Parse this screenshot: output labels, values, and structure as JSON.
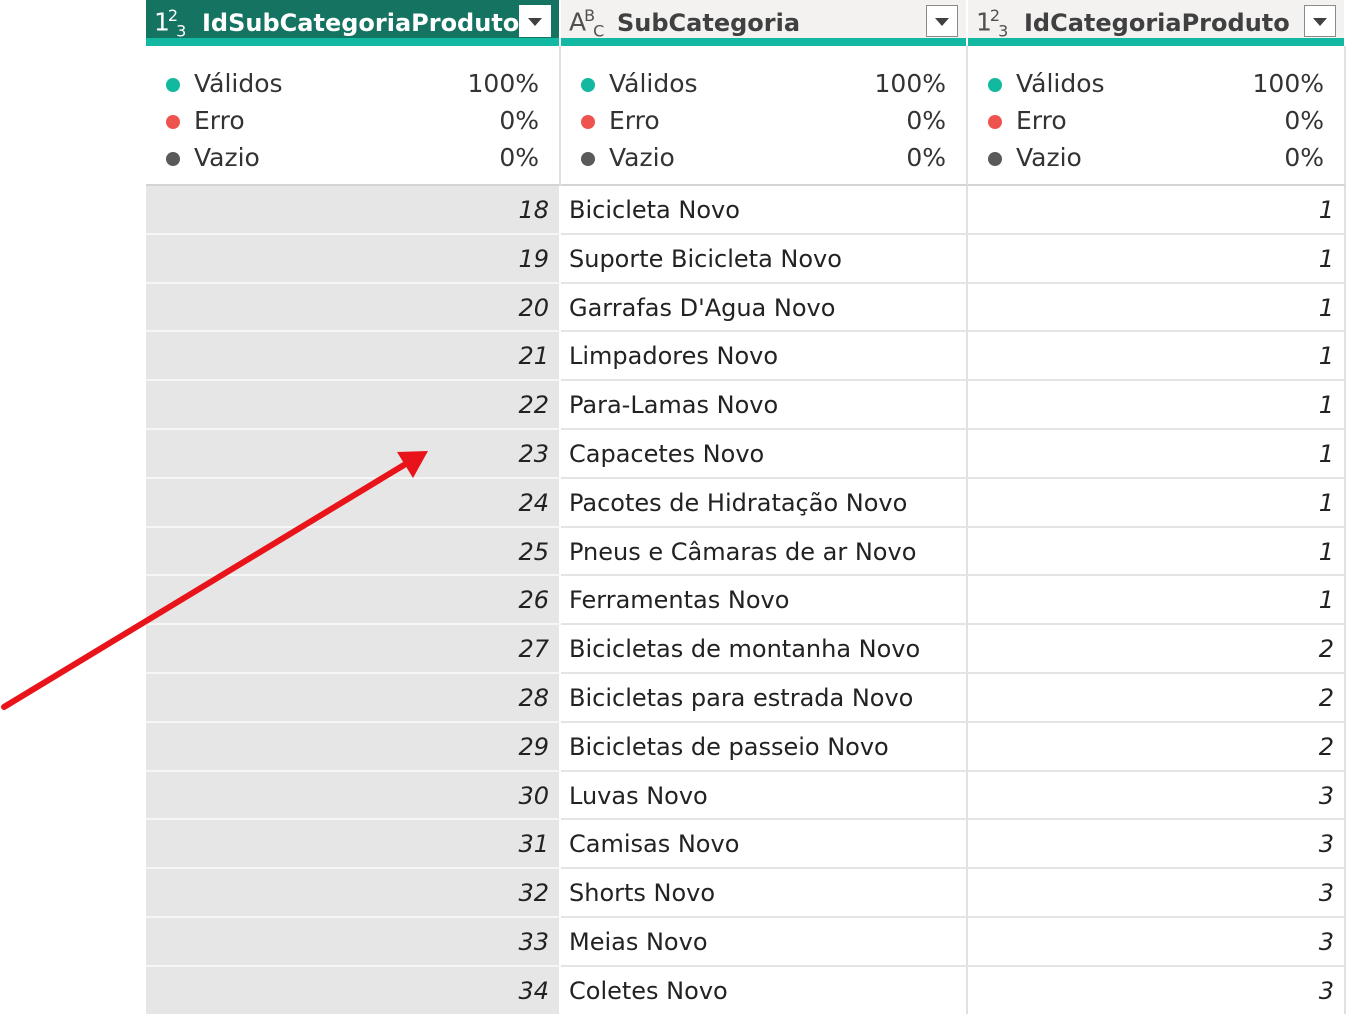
{
  "quality_labels": [
    "Válidos",
    "Erro",
    "Vazio"
  ],
  "quality_colors": {
    "valid": "#12b8a0",
    "error": "#ef5350",
    "empty": "#5a5a5a"
  },
  "columns": [
    {
      "name": "IdSubCategoriaProduto",
      "type_icon": "whole-number-type-icon",
      "selected": true,
      "quality": [
        "100%",
        "0%",
        "0%"
      ]
    },
    {
      "name": "SubCategoria",
      "type_icon": "text-type-icon",
      "selected": false,
      "quality": [
        "100%",
        "0%",
        "0%"
      ]
    },
    {
      "name": "IdCategoriaProduto",
      "type_icon": "whole-number-type-icon",
      "selected": false,
      "quality": [
        "100%",
        "0%",
        "0%"
      ]
    }
  ],
  "rows": [
    [
      "18",
      "Bicicleta Novo",
      "1"
    ],
    [
      "19",
      "Suporte Bicicleta Novo",
      "1"
    ],
    [
      "20",
      "Garrafas D'Agua Novo",
      "1"
    ],
    [
      "21",
      "Limpadores Novo",
      "1"
    ],
    [
      "22",
      "Para-Lamas Novo",
      "1"
    ],
    [
      "23",
      "Capacetes Novo",
      "1"
    ],
    [
      "24",
      "Pacotes de Hidratação Novo",
      "1"
    ],
    [
      "25",
      "Pneus e Câmaras de ar Novo",
      "1"
    ],
    [
      "26",
      "Ferramentas Novo",
      "1"
    ],
    [
      "27",
      "Bicicletas de montanha Novo",
      "2"
    ],
    [
      "28",
      "Bicicletas para estrada Novo",
      "2"
    ],
    [
      "29",
      "Bicicletas de passeio Novo",
      "2"
    ],
    [
      "30",
      "Luvas Novo",
      "3"
    ],
    [
      "31",
      "Camisas Novo",
      "3"
    ],
    [
      "32",
      "Shorts Novo",
      "3"
    ],
    [
      "33",
      "Meias Novo",
      "3"
    ],
    [
      "34",
      "Coletes Novo",
      "3"
    ]
  ],
  "annotation": {
    "type": "arrow",
    "color": "#e8141a"
  }
}
